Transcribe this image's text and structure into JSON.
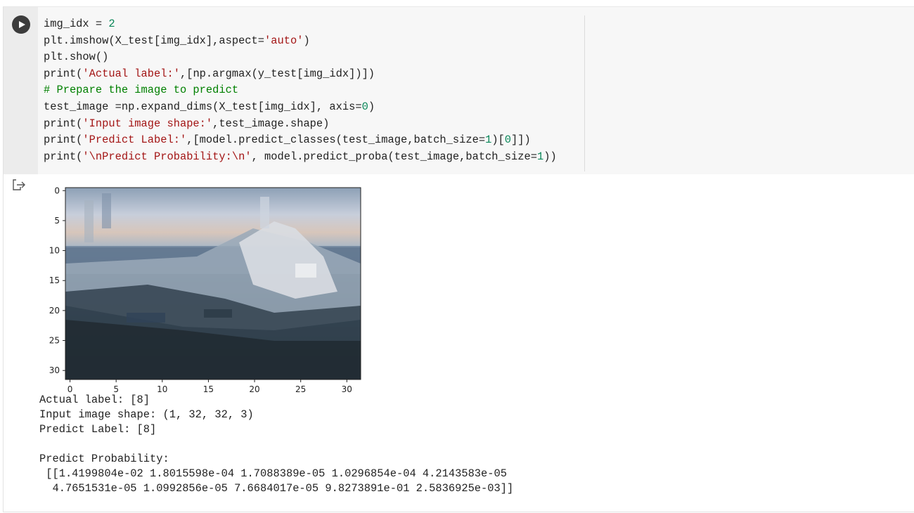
{
  "cell": {
    "run_button_label": "Run cell",
    "code_lines": [
      [
        {
          "t": "img_idx = ",
          "c": ""
        },
        {
          "t": "2",
          "c": "num"
        }
      ],
      [
        {
          "t": "plt.imshow(X_test[img_idx],aspect=",
          "c": ""
        },
        {
          "t": "'auto'",
          "c": "str"
        },
        {
          "t": ")",
          "c": ""
        }
      ],
      [
        {
          "t": "plt.show()",
          "c": ""
        }
      ],
      [
        {
          "t": "print(",
          "c": ""
        },
        {
          "t": "'Actual label:'",
          "c": "str"
        },
        {
          "t": ",[np.argmax(y_test[img_idx])])",
          "c": ""
        }
      ],
      [
        {
          "t": "# Prepare the image to predict",
          "c": "cmt"
        }
      ],
      [
        {
          "t": "test_image =np.expand_dims(X_test[img_idx], axis=",
          "c": ""
        },
        {
          "t": "0",
          "c": "num"
        },
        {
          "t": ")",
          "c": ""
        }
      ],
      [
        {
          "t": "print(",
          "c": ""
        },
        {
          "t": "'Input image shape:'",
          "c": "str"
        },
        {
          "t": ",test_image.shape)",
          "c": ""
        }
      ],
      [
        {
          "t": "print(",
          "c": ""
        },
        {
          "t": "'Predict Label:'",
          "c": "str"
        },
        {
          "t": ",[model.predict_classes(test_image,batch_size=",
          "c": ""
        },
        {
          "t": "1",
          "c": "num"
        },
        {
          "t": ")[",
          "c": ""
        },
        {
          "t": "0",
          "c": "num"
        },
        {
          "t": "]])",
          "c": ""
        }
      ],
      [
        {
          "t": "print(",
          "c": ""
        },
        {
          "t": "'\\nPredict Probability:\\n'",
          "c": "str"
        },
        {
          "t": ", model.predict_proba(test_image,batch_size=",
          "c": ""
        },
        {
          "t": "1",
          "c": "num"
        },
        {
          "t": "))",
          "c": ""
        }
      ]
    ]
  },
  "plot": {
    "x_ticks": [
      "0",
      "5",
      "10",
      "15",
      "20",
      "25",
      "30"
    ],
    "y_ticks": [
      "0",
      "5",
      "10",
      "15",
      "20",
      "25",
      "30"
    ]
  },
  "output": {
    "lines": [
      "Actual label: [8]",
      "Input image shape: (1, 32, 32, 3)",
      "Predict Label: [8]",
      "",
      "Predict Probability:",
      " [[1.4199804e-02 1.8015598e-04 1.7088389e-05 1.0296854e-04 4.2143583e-05",
      "  4.7651531e-05 1.0992856e-05 7.6684017e-05 9.8273891e-01 2.5836925e-03]]"
    ]
  }
}
